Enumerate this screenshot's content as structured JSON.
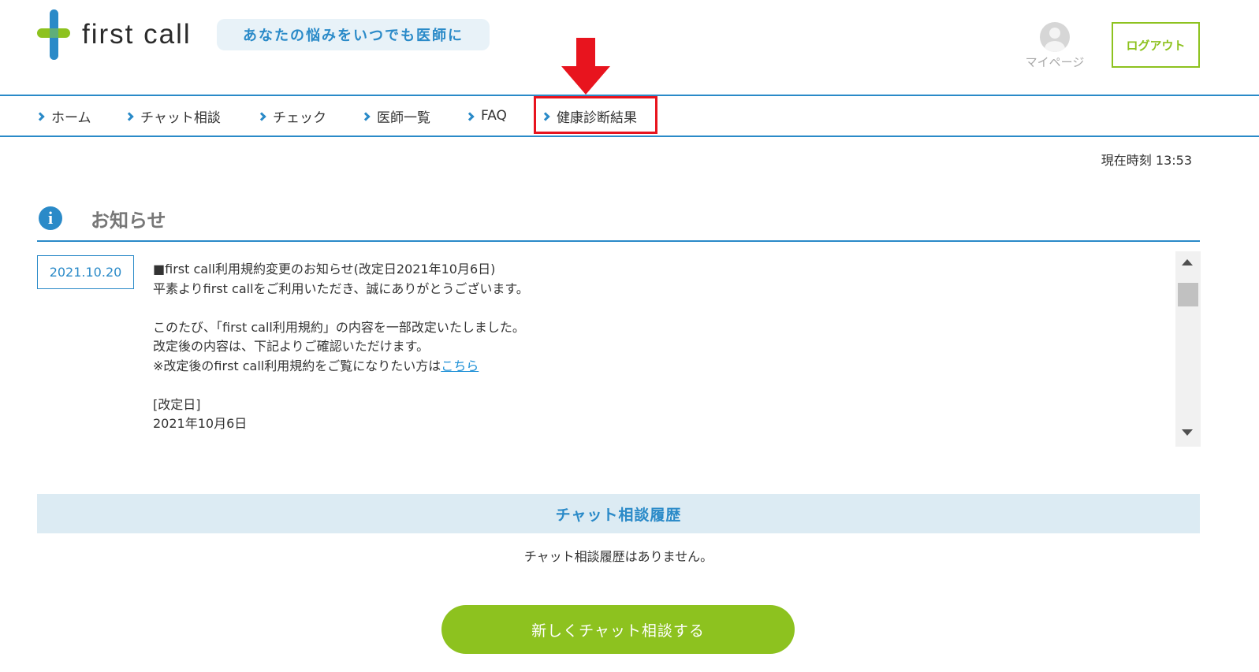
{
  "header": {
    "brand": "first call",
    "tagline": "あなたの悩みをいつでも医師に",
    "mypage_label": "マイページ",
    "logout_label": "ログアウト"
  },
  "nav": {
    "items": [
      {
        "label": "ホーム"
      },
      {
        "label": "チャット相談"
      },
      {
        "label": "チェック"
      },
      {
        "label": "医師一覧"
      },
      {
        "label": "FAQ"
      },
      {
        "label": "健康診断結果"
      }
    ]
  },
  "clock": "現在時刻 13:53",
  "notice": {
    "title": "お知らせ",
    "date": "2021.10.20",
    "lines": [
      "■first call利用規約変更のお知らせ(改定日2021年10月6日)",
      "平素よりfirst callをご利用いただき、誠にありがとうございます。",
      "",
      "このたび、「first call利用規約」の内容を一部改定いたしました。",
      "改定後の内容は、下記よりご確認いただけます。",
      "※改定後のfirst call利用規約をご覧になりたい方は",
      "",
      "[改定日]",
      "2021年10月6日"
    ],
    "link_text": "こちら"
  },
  "history": {
    "title": "チャット相談履歴",
    "empty_message": "チャット相談履歴はありません。"
  },
  "new_chat_label": "新しくチャット相談する",
  "colors": {
    "brand_blue": "#2a8ac8",
    "accent_green": "#8dc21f",
    "annotation_red": "#e8141e"
  }
}
